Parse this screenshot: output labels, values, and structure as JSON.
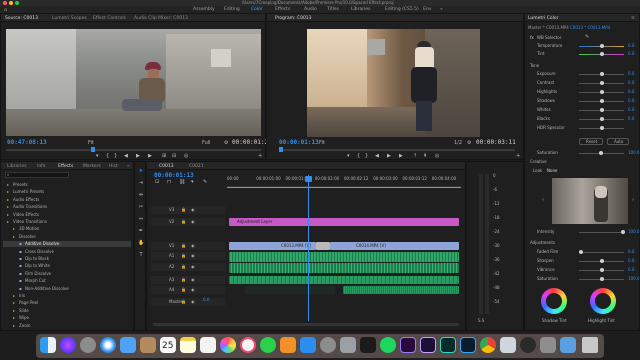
{
  "window": {
    "path": "/Users/7Creeping/Documents/Adobe/Premiere Pro/10.0/Spaced Effect.prproj"
  },
  "workspaces": [
    {
      "label": "Assembly"
    },
    {
      "label": "Editing"
    },
    {
      "label": "Color",
      "active": true
    },
    {
      "label": "Effects"
    },
    {
      "label": "Audio"
    },
    {
      "label": "Titles"
    },
    {
      "label": "Libraries"
    },
    {
      "label": "Editing (CS5.5)"
    },
    {
      "label": "Env"
    }
  ],
  "source_monitor": {
    "tabs": [
      "Source: C0013",
      "Lumetri Scopes",
      "Effect Controls",
      "Audio Clip Mixer: C0013"
    ],
    "timecode_left": "00:47:08:13",
    "fit": "Fit",
    "fraction": "Full",
    "timecode_right": "00:00:01:22"
  },
  "program_monitor": {
    "tab": "Program: C0013",
    "timecode_left": "00:00:01:13",
    "fit": "Fit",
    "fraction": "1/2",
    "timecode_right": "00:00:03:11"
  },
  "lumetri": {
    "tab": "Lumetri Color",
    "master": "Master * C0013.MP4",
    "clip": "C0013 * C0013.MP4",
    "fx_badge": "fx",
    "wb_selector": "WB Selector",
    "sections": {
      "tone": "Tone",
      "creative": "Creative",
      "adjustments": "Adjustments"
    },
    "basic": [
      {
        "label": "Temperature",
        "value": "0.0",
        "pos": 0.5
      },
      {
        "label": "Tint",
        "value": "0.0",
        "pos": 0.5
      }
    ],
    "tone": [
      {
        "label": "Exposure",
        "value": "0.0",
        "pos": 0.5
      },
      {
        "label": "Contrast",
        "value": "0.0",
        "pos": 0.5
      },
      {
        "label": "Highlights",
        "value": "0.0",
        "pos": 0.5
      },
      {
        "label": "Shadows",
        "value": "0.0",
        "pos": 0.5
      },
      {
        "label": "Whites",
        "value": "0.0",
        "pos": 0.5
      },
      {
        "label": "Blacks",
        "value": "0.0",
        "pos": 0.5
      },
      {
        "label": "HDR Specular",
        "value": "",
        "pos": 0.5
      }
    ],
    "reset_label": "Reset",
    "auto_label": "Auto",
    "saturation": {
      "label": "Saturation",
      "value": "100.0"
    },
    "look": {
      "label": "Look",
      "value": "None"
    },
    "intensity": {
      "label": "Intensity",
      "value": "100.0"
    },
    "adjustments": [
      {
        "label": "Faded Film",
        "value": "0.0",
        "pos": 0.05
      },
      {
        "label": "Sharpen",
        "value": "0.0",
        "pos": 0.5
      },
      {
        "label": "Vibrance",
        "value": "0.0",
        "pos": 0.5
      },
      {
        "label": "Saturation",
        "value": "100.0",
        "pos": 0.5
      }
    ],
    "wheels": {
      "shadow": "Shadow Tint",
      "highlight": "Highlight Tint"
    }
  },
  "project_panel": {
    "tabs": [
      "Libraries",
      "Info",
      "Effects",
      "Markers",
      "Hist"
    ],
    "search_placeholder": "",
    "tree": [
      {
        "label": "Presets",
        "indent": 0
      },
      {
        "label": "Lumetri Presets",
        "indent": 0
      },
      {
        "label": "Audio Effects",
        "indent": 0
      },
      {
        "label": "Audio Transitions",
        "indent": 0
      },
      {
        "label": "Video Effects",
        "indent": 0
      },
      {
        "label": "Video Transitions",
        "indent": 0
      },
      {
        "label": "3D Motion",
        "indent": 1
      },
      {
        "label": "Dissolve",
        "indent": 1
      },
      {
        "label": "Additive Dissolve",
        "indent": 2,
        "selected": true
      },
      {
        "label": "Cross Dissolve",
        "indent": 2
      },
      {
        "label": "Dip to Black",
        "indent": 2
      },
      {
        "label": "Dip to White",
        "indent": 2
      },
      {
        "label": "Film Dissolve",
        "indent": 2
      },
      {
        "label": "Morph Cut",
        "indent": 2
      },
      {
        "label": "Non-Additive Dissolve",
        "indent": 2
      },
      {
        "label": "Iris",
        "indent": 1
      },
      {
        "label": "Page Peel",
        "indent": 1
      },
      {
        "label": "Slide",
        "indent": 1
      },
      {
        "label": "Wipe",
        "indent": 1
      },
      {
        "label": "Zoom",
        "indent": 1
      }
    ]
  },
  "timeline": {
    "tabs": [
      "C0013",
      "C0021"
    ],
    "timecode": "00:00:01:13",
    "ruler": [
      "00:00",
      "00:00:01:00",
      "00:00:01:12",
      "00:00:02:00",
      "00:00:02:12",
      "00:00:03:00",
      "00:00:03:12",
      "00:00:04:00"
    ],
    "tracks": [
      "V3",
      "V2",
      "V1",
      "A1",
      "A2",
      "A3",
      "A4",
      "Master"
    ],
    "adjustment_label": "Adjustment Layer",
    "clip_a": "C0013.MP4 [V]",
    "clip_b": "C0014.MP4 [V]",
    "master_value": "0.0"
  },
  "meter": {
    "labels": [
      "0",
      "-6",
      "-12",
      "-18",
      "-24",
      "-30",
      "-36",
      "-42",
      "-48",
      "-54"
    ],
    "footer": "S S"
  },
  "dock": {
    "calendar_day": "25"
  },
  "colors": {
    "accent": "#2e8ff0",
    "adjustment": "#c659c6",
    "video_clip": "#8fa4d6",
    "audio_clip": "#2fa86a"
  }
}
